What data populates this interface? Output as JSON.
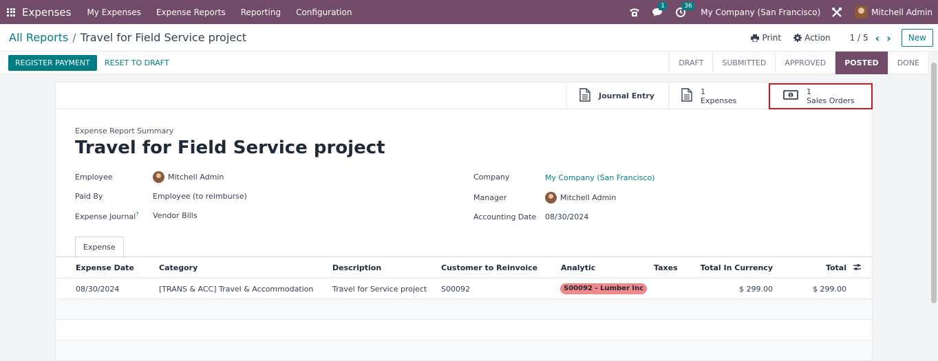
{
  "navbar": {
    "app_name": "Expenses",
    "menu": [
      "My Expenses",
      "Expense Reports",
      "Reporting",
      "Configuration"
    ],
    "chat_badge": "1",
    "activity_badge": "36",
    "company": "My Company (San Francisco)",
    "user": "Mitchell Admin",
    "colors": {
      "brand": "#714b67",
      "accent": "#017e84"
    }
  },
  "breadcrumb": {
    "parent": "All Reports",
    "separator": "/",
    "current": "Travel for Field Service project"
  },
  "control": {
    "print": "Print",
    "action": "Action",
    "pager": "1 / 5",
    "new": "New"
  },
  "statusbar": {
    "register_payment": "REGISTER PAYMENT",
    "reset_to_draft": "RESET TO DRAFT",
    "stages": [
      "DRAFT",
      "SUBMITTED",
      "APPROVED",
      "POSTED",
      "DONE"
    ],
    "active_stage": "POSTED"
  },
  "smart_buttons": {
    "journal_entry": "Journal Entry",
    "expenses_count": "1",
    "expenses_label": "Expenses",
    "sales_orders_count": "1",
    "sales_orders_label": "Sales Orders"
  },
  "form": {
    "subtitle": "Expense Report Summary",
    "title": "Travel for Field Service project",
    "employee_label": "Employee",
    "employee": "Mitchell Admin",
    "paid_by_label": "Paid By",
    "paid_by": "Employee (to reimburse)",
    "journal_label": "Expense Journal",
    "journal_help": "?",
    "journal": "Vendor Bills",
    "company_label": "Company",
    "company": "My Company (San Francisco)",
    "manager_label": "Manager",
    "manager": "Mitchell Admin",
    "accounting_date_label": "Accounting Date",
    "accounting_date": "08/30/2024"
  },
  "tab": {
    "label": "Expense"
  },
  "table": {
    "headers": [
      "Expense Date",
      "Category",
      "Description",
      "Customer to Reinvoice",
      "Analytic",
      "Taxes",
      "Total In Currency",
      "Total"
    ],
    "rows": [
      {
        "date": "08/30/2024",
        "category": "[TRANS & ACC] Travel & Accommodation",
        "description": "Travel for Service project",
        "customer": "S00092",
        "analytic": "S00092 - Lumber Inc",
        "taxes": "",
        "total_currency": "$ 299.00",
        "total": "$ 299.00"
      }
    ]
  }
}
